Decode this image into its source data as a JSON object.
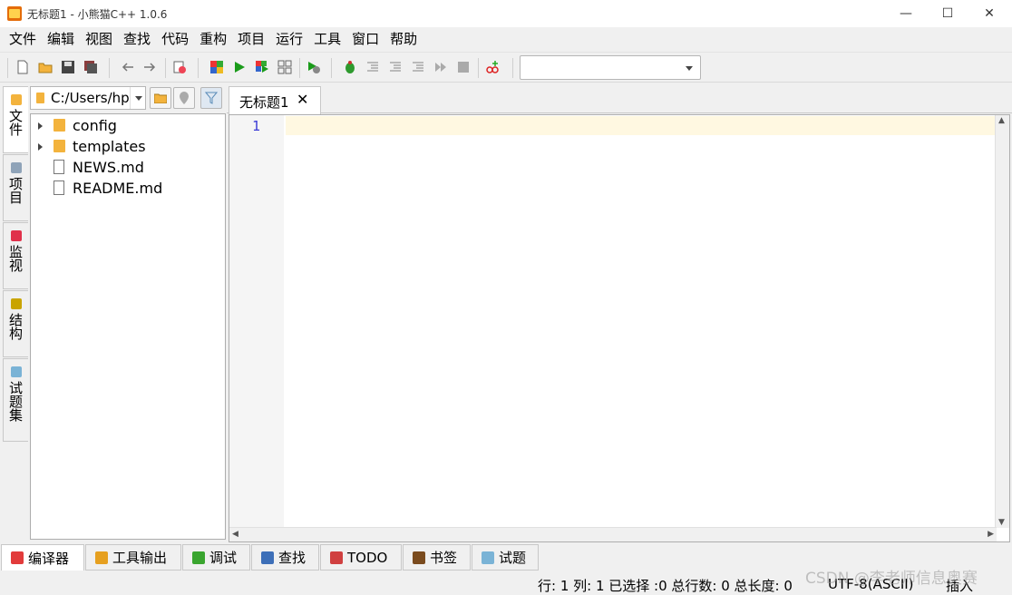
{
  "window": {
    "title": "无标题1 - 小熊猫C++ 1.0.6",
    "controls": {
      "minimize": "—",
      "maximize": "☐",
      "close": "✕"
    }
  },
  "menu": [
    "文件",
    "编辑",
    "视图",
    "查找",
    "代码",
    "重构",
    "项目",
    "运行",
    "工具",
    "窗口",
    "帮助"
  ],
  "toolbar": {
    "icons": [
      "new-file-icon",
      "open-file-icon",
      "save-icon",
      "save-all-icon",
      "undo-icon",
      "redo-icon",
      "format-icon",
      "compile-icon",
      "run-icon",
      "compile-run-icon",
      "rebuild-icon",
      "options-icon",
      "debug-icon",
      "step-over-icon",
      "step-into-icon",
      "step-out-icon",
      "continue-icon",
      "stop-icon",
      "add-watch-icon"
    ],
    "compiler_set": ""
  },
  "left_tabs": [
    {
      "label": "文件",
      "icon": "folder-icon",
      "color": "#f3b33d"
    },
    {
      "label": "项目",
      "icon": "project-icon",
      "color": "#8fa3b8"
    },
    {
      "label": "监视",
      "icon": "watch-icon",
      "color": "#e0314b"
    },
    {
      "label": "结构",
      "icon": "structure-icon",
      "color": "#c9a400"
    },
    {
      "label": "试题集",
      "icon": "problem-set-icon",
      "color": "#7ab3d6"
    }
  ],
  "file_panel": {
    "path": "C:/Users/hp",
    "tree": [
      {
        "name": "config",
        "type": "folder"
      },
      {
        "name": "templates",
        "type": "folder"
      },
      {
        "name": "NEWS.md",
        "type": "file"
      },
      {
        "name": "README.md",
        "type": "file"
      }
    ]
  },
  "editor": {
    "tab_label": "无标题1",
    "close": "✕",
    "line_number": "1"
  },
  "bottom_tabs": [
    {
      "label": "编译器",
      "icon": "compiler-icon",
      "color": "#e23b3b"
    },
    {
      "label": "工具输出",
      "icon": "chart-icon",
      "color": "#e6a020"
    },
    {
      "label": "调试",
      "icon": "debug-icon",
      "color": "#3aa52f"
    },
    {
      "label": "查找",
      "icon": "search-icon",
      "color": "#3d6fb8"
    },
    {
      "label": "TODO",
      "icon": "todo-icon",
      "color": "#d04040"
    },
    {
      "label": "书签",
      "icon": "bookmark-icon",
      "color": "#7a4b1e"
    },
    {
      "label": "试题",
      "icon": "flask-icon",
      "color": "#7ab3d6"
    }
  ],
  "status": {
    "position": "行: 1 列: 1 已选择 :0 总行数: 0 总长度: 0",
    "encoding": "UTF-8(ASCII)",
    "mode": "插入",
    "watermark": "CSDN @李老师信息奥赛"
  }
}
